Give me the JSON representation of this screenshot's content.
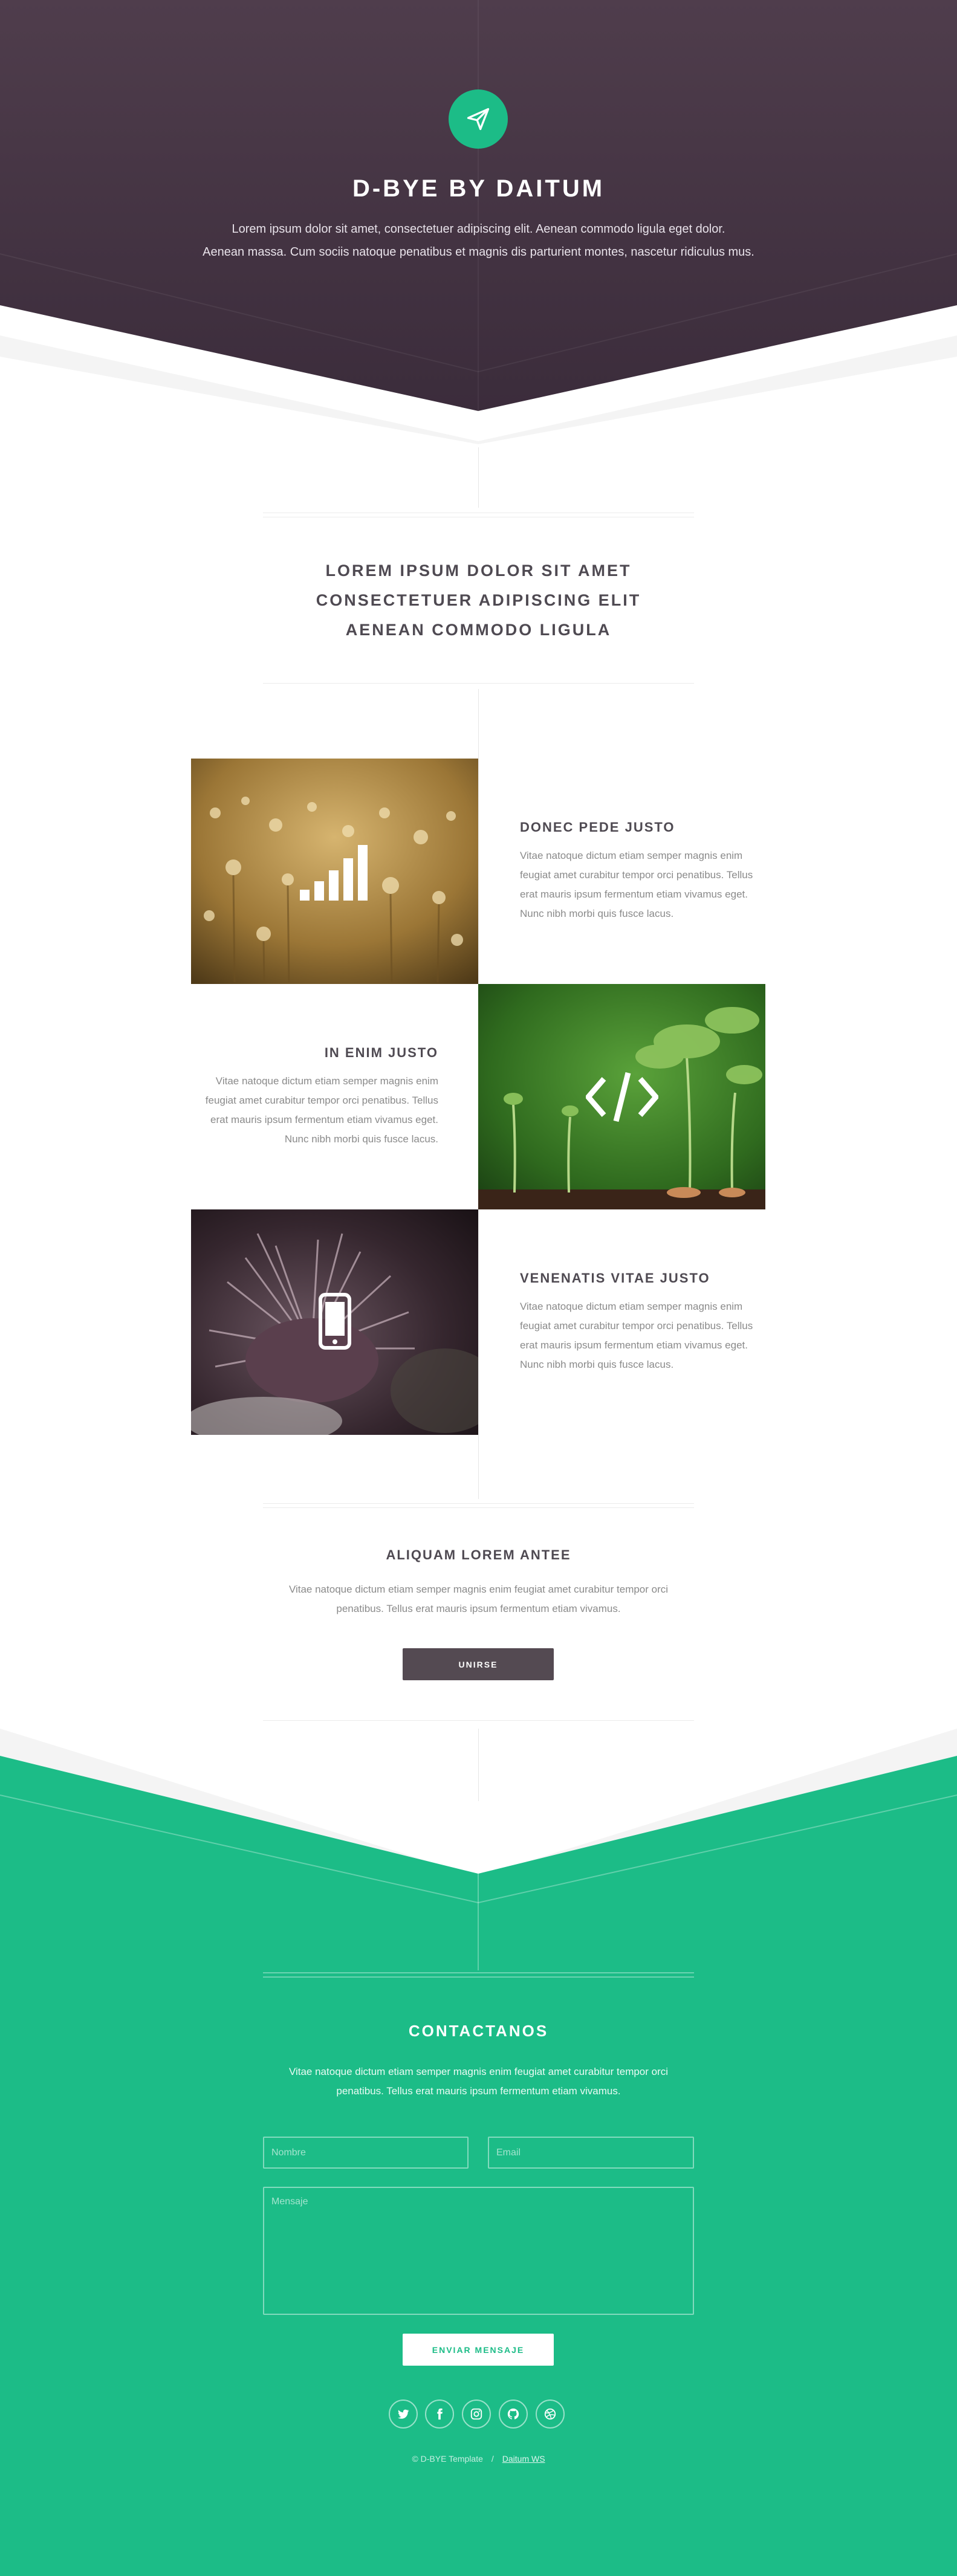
{
  "colors": {
    "header_bg_top": "#4f3d4c",
    "header_bg_bottom": "#3d2d3c",
    "accent": "#1cbc87",
    "button_dark": "#544a52",
    "white": "#ffffff"
  },
  "header": {
    "logo_icon": "paper-plane-icon",
    "title": "D-BYE BY DAITUM",
    "subtitle_line1": "Lorem ipsum dolor sit amet, consectetuer adipiscing elit. Aenean commodo ligula eget dolor.",
    "subtitle_line2": "Aenean massa. Cum sociis natoque penatibus et magnis dis parturient montes, nascetur ridiculus mus."
  },
  "intro": {
    "line1": "LOREM IPSUM DOLOR SIT AMET",
    "line2": "CONSECTETUER ADIPISCING ELIT",
    "line3": "AENEAN COMMODO LIGULA"
  },
  "features": [
    {
      "icon": "signal-bars-icon",
      "title": "DONEC PEDE JUSTO",
      "body": "Vitae natoque dictum etiam semper magnis enim feugiat amet curabitur tempor orci penatibus. Tellus erat mauris ipsum fermentum etiam vivamus eget. Nunc nibh morbi quis fusce lacus."
    },
    {
      "icon": "code-icon",
      "title": "IN ENIM JUSTO",
      "body": "Vitae natoque dictum etiam semper magnis enim feugiat amet curabitur tempor orci penatibus. Tellus erat mauris ipsum fermentum etiam vivamus eget. Nunc nibh morbi quis fusce lacus."
    },
    {
      "icon": "mobile-phone-icon",
      "title": "VENENATIS VITAE JUSTO",
      "body": "Vitae natoque dictum etiam semper magnis enim feugiat amet curabitur tempor orci penatibus. Tellus erat mauris ipsum fermentum etiam vivamus eget. Nunc nibh morbi quis fusce lacus."
    }
  ],
  "cta": {
    "title": "ALIQUAM LOREM ANTEE",
    "body": "Vitae natoque dictum etiam semper magnis enim feugiat amet curabitur tempor orci penatibus. Tellus erat mauris ipsum fermentum etiam vivamus.",
    "button_label": "UNIRSE"
  },
  "contact": {
    "title": "CONTACTANOS",
    "body": "Vitae natoque dictum etiam semper magnis enim feugiat amet curabitur tempor orci penatibus. Tellus erat mauris ipsum fermentum etiam vivamus.",
    "name_placeholder": "Nombre",
    "name_value": "",
    "email_placeholder": "Email",
    "email_value": "",
    "message_placeholder": "Mensaje",
    "message_value": "",
    "send_label": "ENVIAR MENSAJE"
  },
  "social": [
    {
      "icon": "twitter-icon"
    },
    {
      "icon": "facebook-icon"
    },
    {
      "icon": "instagram-icon"
    },
    {
      "icon": "github-icon"
    },
    {
      "icon": "dribbble-icon"
    }
  ],
  "footer": {
    "copyright": "© D-BYE Template",
    "separator": "/",
    "credit_link": "Daitum WS"
  }
}
